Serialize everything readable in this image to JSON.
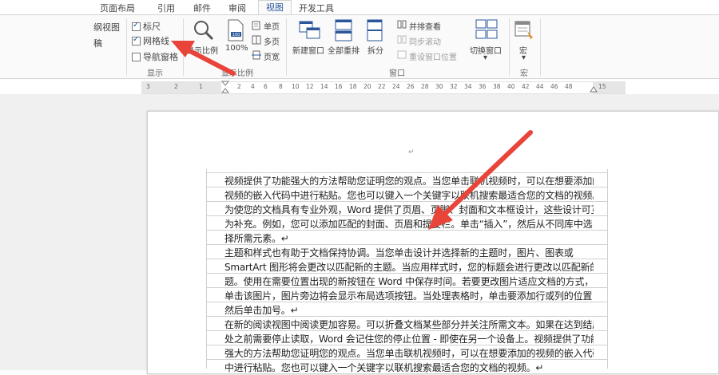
{
  "tabs": [
    "页面布局",
    "引用",
    "邮件",
    "审阅",
    "视图",
    "开发工具"
  ],
  "active_tab": "视图",
  "ribbon": {
    "left_partial": [
      "纲视图",
      "稿"
    ],
    "show": {
      "ruler": {
        "label": "标尺",
        "checked": true
      },
      "gridlines": {
        "label": "网格线",
        "checked": true
      },
      "nav_pane": {
        "label": "导航窗格",
        "checked": false
      },
      "group_label": "显示"
    },
    "zoom": {
      "zoom_label": "显示比例",
      "hundred": "100%",
      "one_page": "单页",
      "multi_page": "多页",
      "page_width": "页宽",
      "group_label": "显示比例"
    },
    "window": {
      "new_window": "新建窗口",
      "arrange_all": "全部重排",
      "split": "拆分",
      "side_by_side": "并排查看",
      "sync_scroll": "同步滚动",
      "reset_pos": "重设窗口位置",
      "switch_window": "切换窗口",
      "switch_arrow": "▾",
      "group_label": "窗口"
    },
    "macro": {
      "label": "宏",
      "arrow": "▾",
      "group_label": "宏"
    }
  },
  "ruler": {
    "numbers": [
      "3",
      "2",
      "1",
      "2",
      "4",
      "6",
      "8",
      "10",
      "12",
      "14",
      "16",
      "18",
      "20",
      "22",
      "24",
      "26",
      "28",
      "30",
      "32",
      "34",
      "36",
      "38",
      "40",
      "42",
      "44",
      "46",
      "48",
      "15"
    ]
  },
  "document": {
    "return_mark": "↵",
    "lines": [
      "视频提供了功能强大的方法帮助您证明您的观点。当您单击联机视频时，可以在想要添加的",
      "视频的嵌入代码中进行粘贴。您也可以键入一个关键字以联机搜索最适合您的文档的视频。",
      "为使您的文档具有专业外观，Word 提供了页眉、页脚、封面和文本框设计，这些设计可互",
      "为补充。例如，您可以添加匹配的封面、页眉和提要栏。单击“插入”，然后从不同库中选",
      "择所需元素。↵",
      "主题和样式也有助于文档保持协调。当您单击设计并选择新的主题时，图片、图表或",
      "SmartArt 图形将会更改以匹配新的主题。当应用样式时，您的标题会进行更改以匹配新的主",
      "题。使用在需要位置出现的新按钮在 Word 中保存时间。若要更改图片适应文档的方式，请",
      "单击该图片，图片旁边将会显示布局选项按钮。当处理表格时，单击要添加行或列的位置，",
      "然后单击加号。↵",
      "在新的阅读视图中阅读更加容易。可以折叠文档某些部分并关注所需文本。如果在达到结尾",
      "处之前需要停止读取，Word 会记住您的停止位置 - 即使在另一个设备上。视频提供了功能",
      "强大的方法帮助您证明您的观点。当您单击联机视频时，可以在想要添加的视频的嵌入代码",
      "中进行粘贴。您也可以键入一个关键字以联机搜索最适合您的文档的视频。↵"
    ]
  },
  "colors": {
    "accent": "#2b579a",
    "arrow": "#e8443a",
    "ribbon_bg": "#fafafa",
    "doc_bg": "#f0f0f0"
  }
}
